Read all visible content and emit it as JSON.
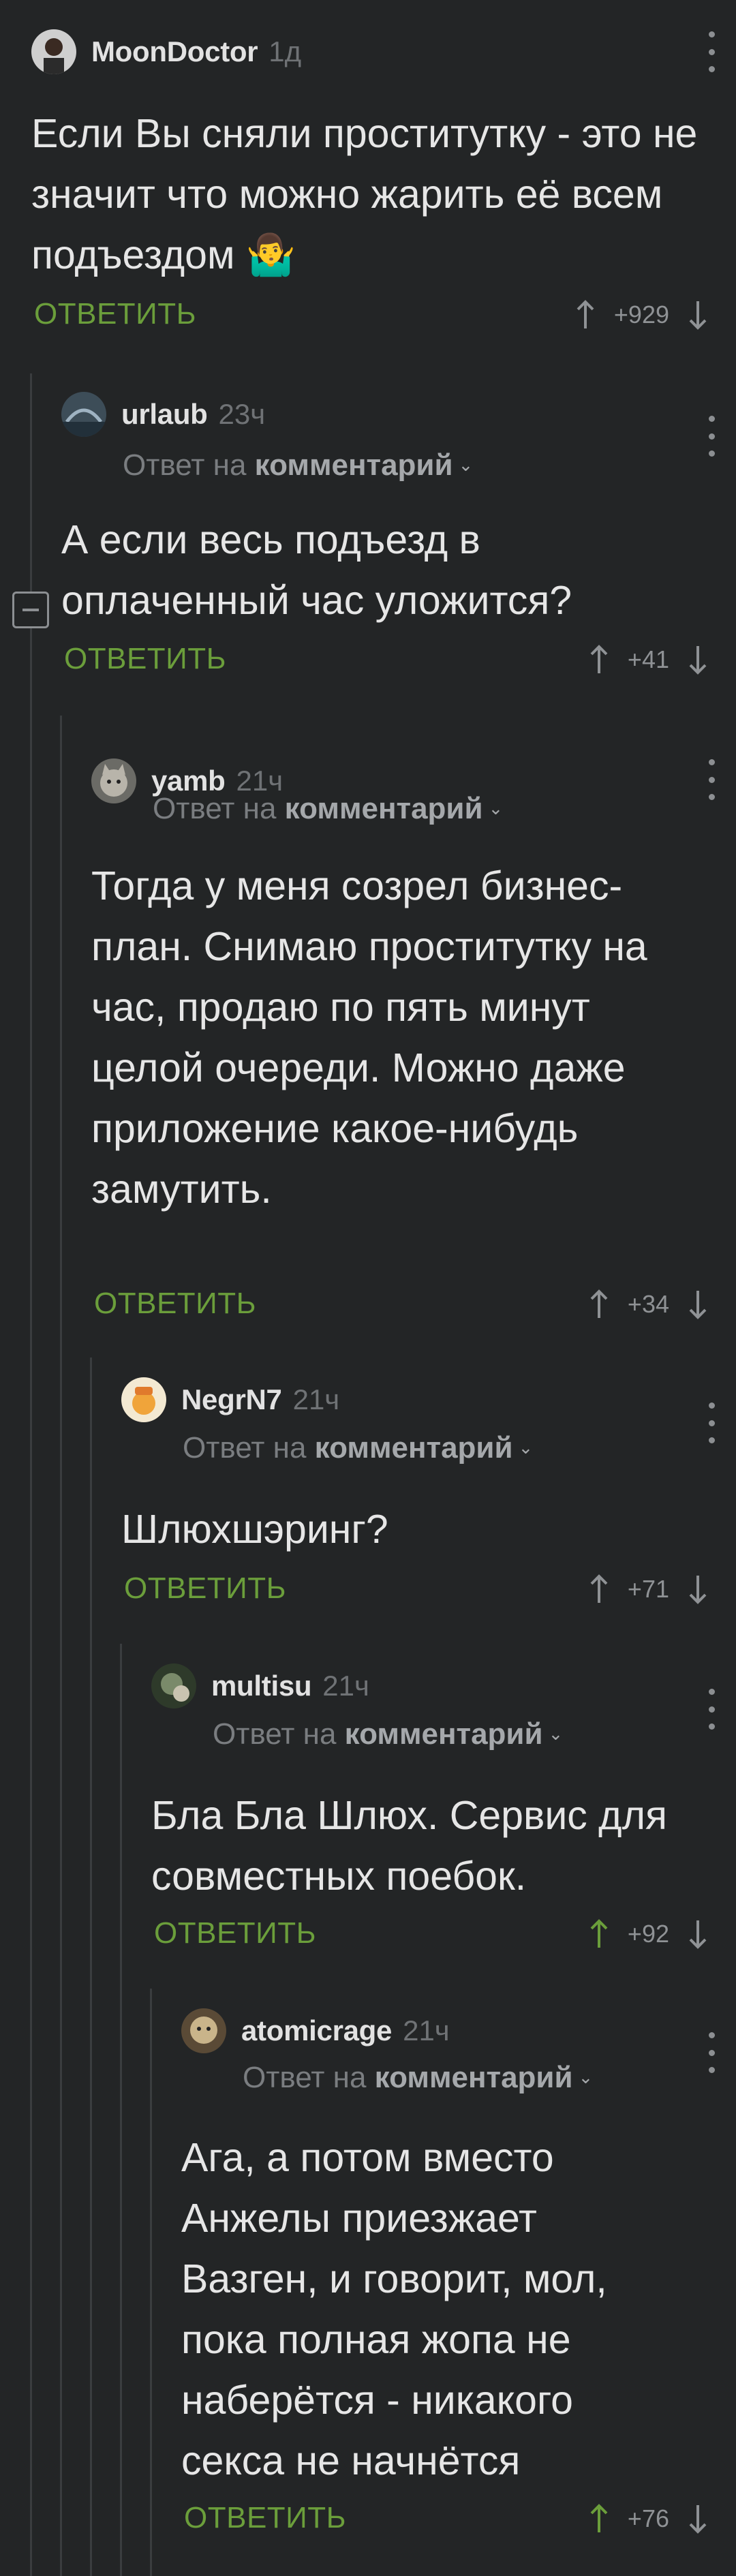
{
  "common": {
    "reply_to_prefix": "Ответ на",
    "reply_to_link": "комментарий",
    "reply_label": "ОТВЕТИТЬ",
    "chevron": "⌄"
  },
  "comments": [
    {
      "author": "MoonDoctor",
      "time": "1д",
      "text": "Если Вы сняли проститутку - это не значит что можно жарить её всем подъездом 🤷‍♂️",
      "votes": "+929"
    },
    {
      "author": "urlaub",
      "time": "23ч",
      "text": "А если весь подъезд в оплаченный час уложится?",
      "votes": "+41"
    },
    {
      "author": "yamb",
      "time": "21ч",
      "text": "Тогда у меня созрел бизнес-план. Снимаю проститутку на час, продаю по пять минут целой очереди. Можно даже приложение какое-нибудь замутить.",
      "votes": "+34"
    },
    {
      "author": "NegrN7",
      "time": "21ч",
      "text": "Шлюхшэринг?",
      "votes": "+71"
    },
    {
      "author": "multisu",
      "time": "21ч",
      "text": "Бла Бла Шлюх. Сервис для совместных поебок.",
      "votes": "+92"
    },
    {
      "author": "atomicrage",
      "time": "21ч",
      "text": "Ага, а потом вместо Анжелы приезжает Вазген, и говорит, мол, пока полная жопа не наберётся - никакого секса не начнётся",
      "votes": "+76"
    }
  ],
  "colors": {
    "background": "#232526",
    "reply_green": "#6b9e3b",
    "upvoted_green": "#6b9e3b",
    "thread_line": "#3a3d3f"
  },
  "icons": {
    "menu": "vertical-dots-icon",
    "upvote": "arrow-up-icon",
    "downvote": "arrow-down-icon",
    "collapse": "collapse-minus-icon"
  }
}
